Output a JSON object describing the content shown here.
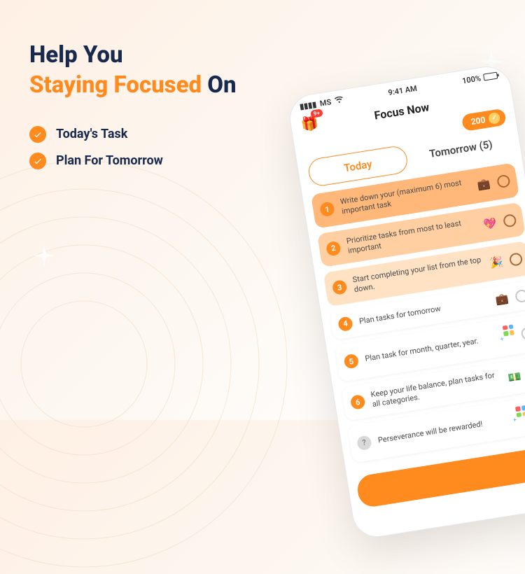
{
  "marketing": {
    "heading_line1": "Help You",
    "heading_line2_accent": "Staying Focused",
    "heading_line2_rest": "On",
    "bullets": [
      "Today's Task",
      "Plan For Tomorrow"
    ]
  },
  "statusbar": {
    "carrier": "MS",
    "time": "9:41 AM",
    "battery_percent": "100%"
  },
  "app": {
    "title": "Focus Now",
    "gift_badge": "9+",
    "points": "200",
    "tabs": {
      "today": "Today",
      "tomorrow": "Tomorrow (5)"
    }
  },
  "tasks": [
    {
      "num": "1",
      "text": "Write down your (maximum 6) most important task",
      "icon": "briefcase",
      "tier": "hi1"
    },
    {
      "num": "2",
      "text": "Prioritize tasks from most to least important",
      "icon": "heart",
      "tier": "hi2"
    },
    {
      "num": "3",
      "text": "Start completing your list from the top down.",
      "icon": "party",
      "tier": "hi3"
    },
    {
      "num": "4",
      "text": "Plan tasks for tomorrow",
      "icon": "briefcase",
      "tier": "plain"
    },
    {
      "num": "5",
      "text": "Plan task for month, quarter, year.",
      "icon": "apps",
      "tier": "plain"
    },
    {
      "num": "6",
      "text": "Keep your life balance, plan tasks for all categories.",
      "icon": "money",
      "tier": "plain"
    },
    {
      "num": "?",
      "text": "Perseverance will be rewarded!",
      "icon": "apps",
      "tier": "plain",
      "grey": true
    }
  ],
  "icon_map": {
    "briefcase": "💼",
    "heart": "💖",
    "party": "🎉",
    "money": "💵"
  }
}
